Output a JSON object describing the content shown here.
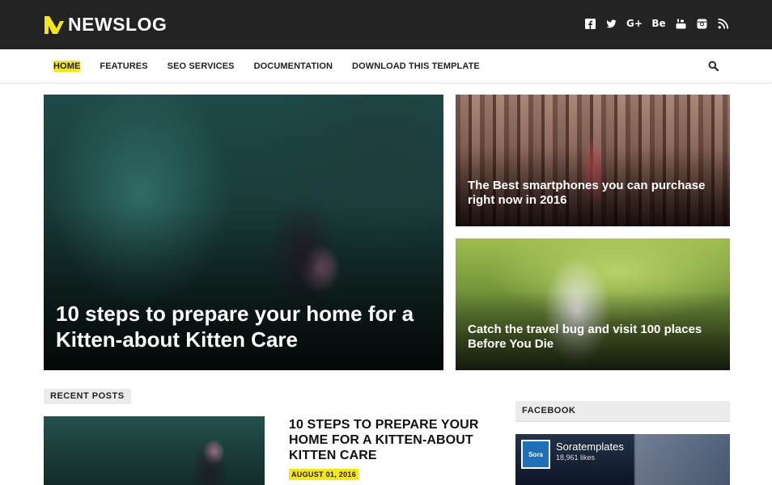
{
  "brand": {
    "name": "NEWSLOG",
    "accent": "#f5e61a"
  },
  "social": [
    "facebook-icon",
    "twitter-icon",
    "google-plus-icon",
    "behance-icon",
    "youtube-icon",
    "instagram-icon",
    "rss-icon"
  ],
  "social_glyphs": {
    "gplus": "G+",
    "behance": "Be"
  },
  "nav": {
    "items": [
      "HOME",
      "FEATURES",
      "SEO SERVICES",
      "DOCUMENTATION",
      "DOWNLOAD THIS TEMPLATE"
    ]
  },
  "featured": {
    "main_title": "10 steps to prepare your home for a Kitten-about Kitten Care",
    "top_title": "The Best smartphones you can purchase right now in 2016",
    "bottom_title": "Catch the travel bug and visit 100 places Before You Die"
  },
  "recent": {
    "label": "RECENT POSTS",
    "post_title": "10 STEPS TO PREPARE YOUR HOME FOR A KITTEN-ABOUT KITTEN CARE",
    "post_date": "AUGUST 01, 2016"
  },
  "sidebar": {
    "facebook_label": "FACEBOOK",
    "page_name": "Soratemplates",
    "page_likes": "18,961 likes",
    "avatar_text": "Sora"
  }
}
